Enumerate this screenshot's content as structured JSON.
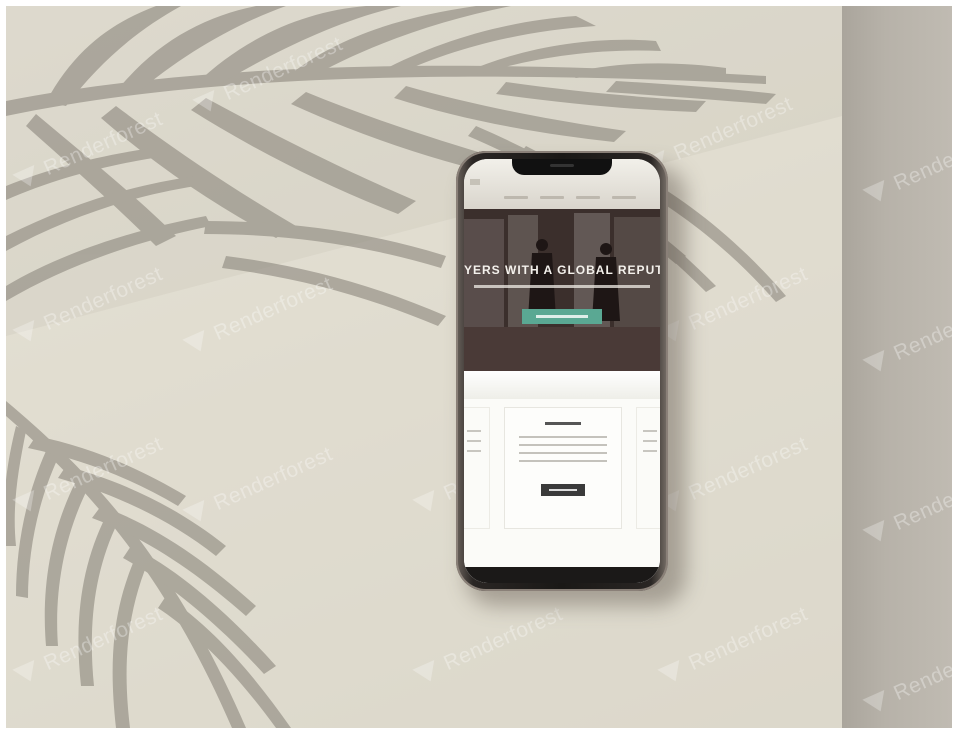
{
  "watermark": {
    "text": "Renderforest"
  },
  "phone_site": {
    "hero_title": "YERS WITH A GLOBAL REPUTA"
  },
  "colors": {
    "wall": "#dcd8cb",
    "palm_shadow": "#8f8a80",
    "phone_frame": "#1a1816",
    "cta": "#5aa893"
  }
}
